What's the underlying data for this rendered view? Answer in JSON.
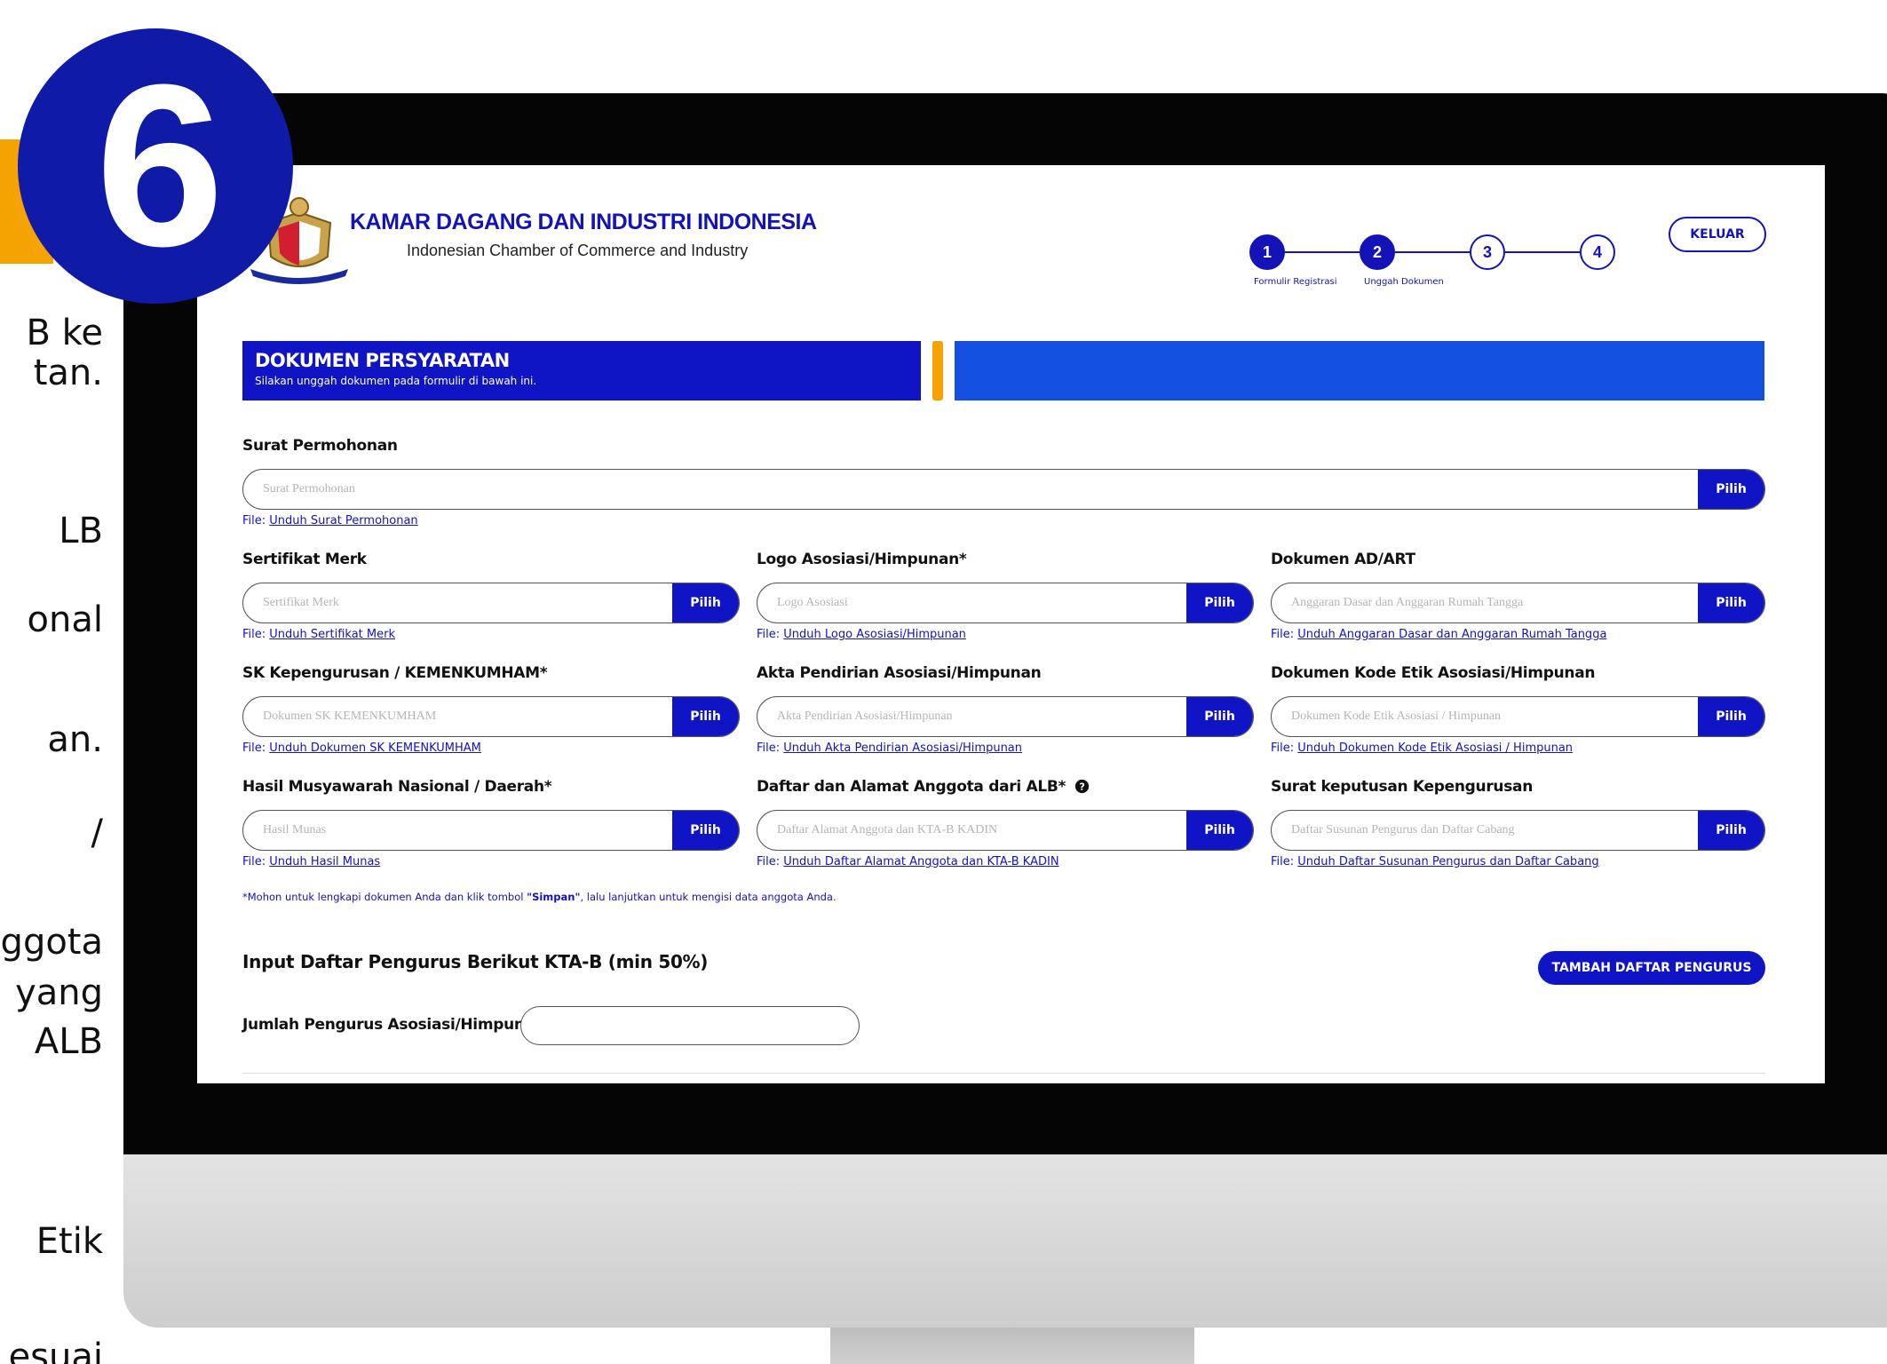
{
  "step_number": "6",
  "side_text": [
    {
      "text": "B ke",
      "top": 0
    },
    {
      "text": "tan.",
      "top": 0
    },
    {
      "text": "LB",
      "top": 0
    },
    {
      "text": "onal",
      "top": 0
    },
    {
      "text": "an.",
      "top": 0
    },
    {
      "text": "/",
      "top": 0
    },
    {
      "text": "ggota",
      "top": 0
    },
    {
      "text": "yang",
      "top": 0
    },
    {
      "text": "ALB",
      "top": 0
    },
    {
      "text": "Etik",
      "top": 0
    },
    {
      "text": "esuai",
      "top": 0
    }
  ],
  "header": {
    "org_name": "KAMAR DAGANG DAN INDUSTRI INDONESIA",
    "org_subtitle": "Indonesian Chamber of Commerce and Industry",
    "logout_label": "KELUAR"
  },
  "stepper": {
    "steps": [
      "1",
      "2",
      "3",
      "4"
    ],
    "labels": [
      "Formulir Registrasi",
      "Unggah Dokumen"
    ],
    "active_count": 2
  },
  "banner": {
    "title": "DOKUMEN PERSYARATAN",
    "subtitle": "Silakan unggah dokumen pada formulir di bawah ini."
  },
  "fields": {
    "surat_permohonan": {
      "label": "Surat Permohonan",
      "placeholder": "Surat Permohonan",
      "button": "Pilih",
      "file_prefix": "File:",
      "link": "Unduh Surat Permohonan"
    },
    "sertifikat_merk": {
      "label": "Sertifikat Merk",
      "placeholder": "Sertifikat Merk",
      "button": "Pilih",
      "file_prefix": "File:",
      "link": "Unduh Sertifikat Merk"
    },
    "logo_asosiasi": {
      "label": "Logo Asosiasi/Himpunan*",
      "placeholder": "Logo Asosiasi",
      "button": "Pilih",
      "file_prefix": "File:",
      "link": "Unduh Logo Asosiasi/Himpunan"
    },
    "dokumen_adart": {
      "label": "Dokumen AD/ART",
      "placeholder": "Anggaran Dasar dan Anggaran Rumah Tangga",
      "button": "Pilih",
      "file_prefix": "File:",
      "link": "Unduh Anggaran Dasar dan Anggaran Rumah Tangga"
    },
    "sk_kepengurusan": {
      "label": "SK Kepengurusan / KEMENKUMHAM*",
      "placeholder": "Dokumen SK KEMENKUMHAM",
      "button": "Pilih",
      "file_prefix": "File:",
      "link": "Unduh Dokumen SK KEMENKUMHAM"
    },
    "akta_pendirian": {
      "label": "Akta Pendirian Asosiasi/Himpunan",
      "placeholder": "Akta Pendirian Asosiasi/Himpunan",
      "button": "Pilih",
      "file_prefix": "File:",
      "link": "Unduh Akta Pendirian Asosiasi/Himpunan"
    },
    "kode_etik": {
      "label": "Dokumen Kode Etik Asosiasi/Himpunan",
      "placeholder": "Dokumen Kode Etik Asosiasi / Himpunan",
      "button": "Pilih",
      "file_prefix": "File:",
      "link": "Unduh Dokumen Kode Etik Asosiasi / Himpunan"
    },
    "hasil_munas": {
      "label": "Hasil Musyawarah Nasional / Daerah*",
      "placeholder": "Hasil Munas",
      "button": "Pilih",
      "file_prefix": "File:",
      "link": "Unduh Hasil Munas"
    },
    "daftar_anggota": {
      "label": "Daftar dan Alamat Anggota dari ALB*",
      "placeholder": "Daftar Alamat Anggota dan KTA-B KADIN",
      "button": "Pilih",
      "file_prefix": "File:",
      "link": "Unduh Daftar Alamat Anggota dan KTA-B KADIN"
    },
    "sk_kepengurusan_surat": {
      "label": "Surat keputusan Kepengurusan",
      "placeholder": "Daftar Susunan Pengurus dan Daftar Cabang",
      "button": "Pilih",
      "file_prefix": "File:",
      "link": "Unduh Daftar Susunan Pengurus dan Daftar Cabang"
    }
  },
  "note": {
    "before": "*Mohon untuk lengkapi dokumen Anda dan klik tombol ",
    "bold": "\"Simpan\"",
    "after": ", lalu lanjutkan untuk mengisi data anggota Anda."
  },
  "pengurus": {
    "section_title": "Input Daftar Pengurus Berikut KTA-B (min 50%)",
    "add_button": "TAMBAH DAFTAR PENGURUS",
    "count_label": "Jumlah Pengurus Asosiasi/Himpunan",
    "count_value": ""
  },
  "colors": {
    "brand_blue": "#0f14c4",
    "accent_orange": "#f5a300",
    "badge_blue": "#0f1aa6"
  }
}
